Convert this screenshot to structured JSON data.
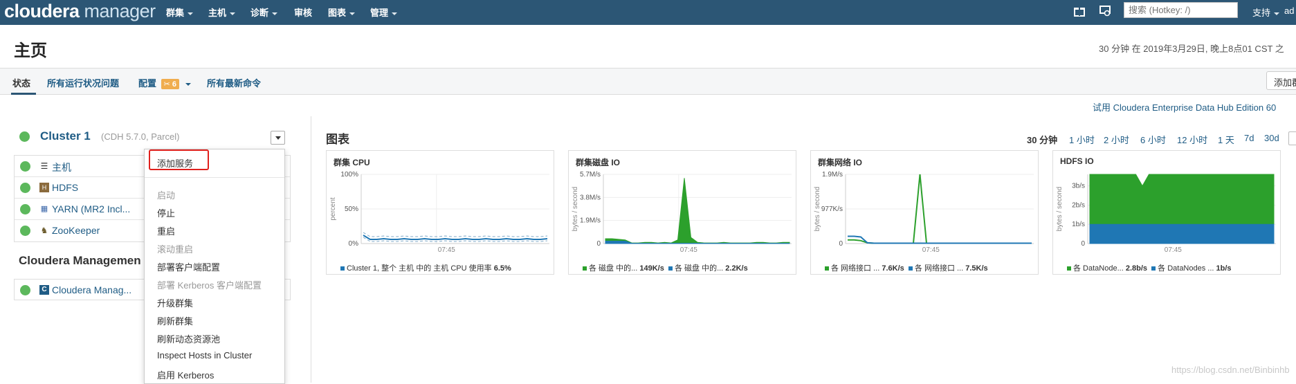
{
  "topnav": {
    "brand_bold": "cloudera",
    "brand_rest": " manager",
    "items": [
      "群集",
      "主机",
      "诊断",
      "审核",
      "图表",
      "管理"
    ],
    "search_placeholder": "搜索 (Hotkey: /)",
    "support": "支持",
    "user": "ad"
  },
  "header": {
    "title": "主页",
    "time_info": "30 分钟 在 2019年3月29日, 晚上8点01 CST 之"
  },
  "tabs": {
    "status": "状态",
    "health_issues": "所有运行状况问题",
    "config": "配置",
    "config_badge": "6",
    "recent_commands": "所有最新命令",
    "add_button": "添加群"
  },
  "trial_link": "试用 Cloudera Enterprise Data Hub Edition 60",
  "cluster": {
    "name": "Cluster 1",
    "meta": "(CDH 5.7.0, Parcel)",
    "services": [
      {
        "label": "主机",
        "icon": "hosts-list-icon"
      },
      {
        "label": "HDFS",
        "icon": "hdfs-icon"
      },
      {
        "label": "YARN (MR2 Incl...",
        "icon": "yarn-icon"
      },
      {
        "label": "ZooKeeper",
        "icon": "zookeeper-icon"
      }
    ]
  },
  "management": {
    "title": "Cloudera Managemen",
    "service": "Cloudera Manag..."
  },
  "menu": {
    "add_service": "添加服务",
    "items": [
      {
        "label": "启动",
        "disabled": true
      },
      {
        "label": "停止",
        "disabled": false
      },
      {
        "label": "重启",
        "disabled": false
      },
      {
        "label": "滚动重启",
        "disabled": true
      },
      {
        "label": "部署客户端配置",
        "disabled": false
      },
      {
        "label": "部署 Kerberos 客户端配置",
        "disabled": true
      },
      {
        "label": "升级群集",
        "disabled": false
      },
      {
        "label": "刷新群集",
        "disabled": false
      },
      {
        "label": "刷新动态资源池",
        "disabled": false
      },
      {
        "label": "Inspect Hosts in Cluster",
        "disabled": false
      },
      {
        "label": "启用 Kerberos",
        "disabled": false
      }
    ]
  },
  "charts_section": {
    "title": "图表",
    "ranges": [
      "30 分钟",
      "1 小时",
      "2 小时",
      "6 小时",
      "12 小时",
      "1 天",
      "7d",
      "30d"
    ]
  },
  "colors": {
    "nav_bg": "#2c5675",
    "link": "#1f5c85",
    "status_green": "#5cb85c",
    "series_green": "#2ca02c",
    "series_blue": "#1f77b4",
    "highlight_red": "#e0201c"
  },
  "chart_data": [
    {
      "type": "line",
      "title": "群集 CPU",
      "ylabel": "percent",
      "yticks": [
        "100%",
        "50%",
        "0%"
      ],
      "ylim": [
        0,
        100
      ],
      "xtick": "07:45",
      "series": [
        {
          "name": "Cluster 1, 整个 主机 中的 主机 CPU 使用率",
          "summary": "6.5%",
          "values": [
            12,
            6,
            6,
            7,
            6,
            6,
            7,
            6,
            6,
            7,
            6,
            6,
            7,
            6,
            6,
            7,
            6,
            6,
            7,
            6,
            6,
            7,
            6,
            6,
            7,
            6,
            6,
            7
          ]
        }
      ]
    },
    {
      "type": "area",
      "title": "群集磁盘 IO",
      "ylabel": "bytes / second",
      "yticks": [
        "5.7M/s",
        "3.8M/s",
        "1.9M/s",
        "0"
      ],
      "ylim": [
        0,
        5.7
      ],
      "xtick": "07:45",
      "series": [
        {
          "name": "各 磁盘 中的...",
          "summary": "149K/s",
          "values": [
            0.4,
            0.4,
            0.35,
            0.3,
            0.05,
            0.05,
            0.1,
            0.1,
            0.05,
            0.1,
            0.05,
            0.3,
            5.4,
            0.5,
            0.1,
            0.05,
            0.05,
            0.05,
            0.1,
            0.05,
            0.05,
            0.05,
            0.05,
            0.1,
            0.1,
            0.05,
            0.05,
            0.1,
            0.1
          ]
        },
        {
          "name": "各 磁盘 中的...",
          "summary": "2.2K/s",
          "values": [
            0.2,
            0.2,
            0.2,
            0.2,
            0.02,
            0.02,
            0.02,
            0.02,
            0.02,
            0.02,
            0.02,
            0.02,
            0.02,
            0.02,
            0.02,
            0.02,
            0.02,
            0.02,
            0.02,
            0.02,
            0.02,
            0.02,
            0.02,
            0.02,
            0.02,
            0.02,
            0.02,
            0.02,
            0.02
          ]
        }
      ]
    },
    {
      "type": "line",
      "title": "群集网络 IO",
      "ylabel": "bytes / second",
      "yticks": [
        "1.9M/s",
        "977K/s",
        "0"
      ],
      "ylim": [
        0,
        1.9
      ],
      "xtick": "07:45",
      "series": [
        {
          "name": "各 网络接口 ...",
          "summary": "7.6K/s",
          "values": [
            0.1,
            0.1,
            0.08,
            0.02,
            0.01,
            0.01,
            0.01,
            0.01,
            0.01,
            0.01,
            0.01,
            2.3,
            0.01,
            0.01,
            0.01,
            0.01,
            0.01,
            0.01,
            0.01,
            0.01,
            0.01,
            0.01,
            0.01,
            0.01,
            0.01,
            0.01,
            0.01,
            0.01,
            0.01
          ]
        },
        {
          "name": "各 网络接口 ...",
          "summary": "7.5K/s",
          "values": [
            0.2,
            0.2,
            0.18,
            0.02,
            0.01,
            0.01,
            0.01,
            0.01,
            0.01,
            0.01,
            0.01,
            0.01,
            0.01,
            0.01,
            0.01,
            0.01,
            0.01,
            0.01,
            0.01,
            0.01,
            0.01,
            0.01,
            0.01,
            0.01,
            0.01,
            0.01,
            0.01,
            0.01,
            0.01
          ]
        }
      ]
    },
    {
      "type": "area",
      "title": "HDFS IO",
      "ylabel": "bytes / second",
      "yticks": [
        "3b/s",
        "2b/s",
        "1b/s",
        "0"
      ],
      "ylim": [
        0,
        3.6
      ],
      "xtick": "07:45",
      "series": [
        {
          "name": "各 DataNode...",
          "summary": "2.8b/s",
          "values": [
            3.6,
            3.6,
            3.6,
            3.6,
            3.6,
            3.6,
            3.6,
            3.6,
            3.0,
            3.6,
            3.6,
            3.6,
            3.6,
            3.6,
            3.6,
            3.6,
            3.6,
            3.6,
            3.6,
            3.6,
            3.6,
            3.6,
            3.6,
            3.6,
            3.6,
            3.6,
            3.6,
            3.6,
            3.6
          ]
        },
        {
          "name": "各 DataNodes ...",
          "summary": "1b/s",
          "values": [
            1,
            1,
            1,
            1,
            1,
            1,
            1,
            1,
            1,
            1,
            1,
            1,
            1,
            1,
            1,
            1,
            1,
            1,
            1,
            1,
            1,
            1,
            1,
            1,
            1,
            1,
            1,
            1,
            1
          ]
        }
      ]
    }
  ],
  "watermark": "https://blog.csdn.net/Binbinhb"
}
